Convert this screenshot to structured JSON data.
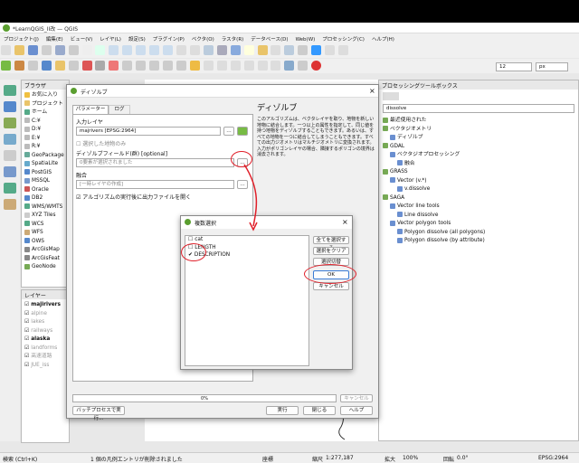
{
  "window_title": "*LearnQGIS_II改 — QGIS",
  "menu": [
    "プロジェクト(J)",
    "編集(E)",
    "ビュー(V)",
    "レイヤ(L)",
    "設定(S)",
    "プラグイン(P)",
    "ベクタ(O)",
    "ラスタ(R)",
    "データベース(D)",
    "Web(W)",
    "プロセッシング(C)",
    "ヘルプ(H)"
  ],
  "toolbar": {
    "zoom_value": "12",
    "zoom_unit": "px"
  },
  "browser": {
    "title": "ブラウザ",
    "items": [
      "お気に入り",
      "プロジェクト",
      "ホーム",
      "C:¥",
      "D:¥",
      "E:¥",
      "R:¥",
      "GeoPackage",
      "SpatiaLite",
      "PostGIS",
      "MSSQL",
      "Oracle",
      "DB2",
      "WMS/WMTS",
      "XYZ Tiles",
      "WCS",
      "WFS",
      "OWS",
      "ArcGisMap",
      "ArcGisFeat",
      "GeoNode"
    ]
  },
  "layers": {
    "title": "レイヤー",
    "items": [
      "majirivers",
      "alpine",
      "lakes",
      "railways",
      "alaska",
      "landforms",
      "高速道路",
      "JUE_iss"
    ]
  },
  "dissolve": {
    "title": "ディゾルブ",
    "tab_params": "パラメーター",
    "tab_log": "ログ",
    "input_label": "入力レイヤ",
    "input_value": "majrivers [EPSG:2964]",
    "selected_only": "選択した地物のみ",
    "field_label": "ディゾルブフィールド(群) [optional]",
    "field_value": "0要素が選択されました",
    "output_label": "融合",
    "output_value": "[一時レイヤの作成]",
    "open_output": "アルゴリズムの実行後に出力ファイルを開く",
    "help_title": "ディゾルブ",
    "help_text": "このアルゴリズムは、ベクタレイヤを取り、地物を新しい地物に結合します。一つ以上の属性を指定して、同じ値を持つ地物をディゾルブすることもできます。あるいは、すべての地物を一つに結合してしまうこともできます。すべての出力ジオメトリはマルチジオメトリに変換されます。入力がポリゴンレイヤの場合、隣接するポリゴンの境界は消去されます。",
    "progress": "0%",
    "cancel": "キャンセル",
    "batch": "バッチプロセスで実行...",
    "run": "実行",
    "close": "閉じる",
    "help": "ヘルプ"
  },
  "multi": {
    "title": "複数選択",
    "items": [
      "cat",
      "LENGTH",
      "DESCRIPTION"
    ],
    "checked": [
      false,
      false,
      true
    ],
    "select_all": "全てを選択する",
    "clear": "選択をクリア",
    "toggle": "選択切替",
    "ok": "OK",
    "cancel": "キャンセル"
  },
  "processing": {
    "title": "プロセッシングツールボックス",
    "search": "dissolve",
    "items": [
      "最近使用された",
      "ベクタジオメトリ",
      "ディゾルブ",
      "GDAL",
      "ベクタジオプロセッシング",
      "融合",
      "GRASS",
      "Vector (v.*)",
      "v.dissolve",
      "SAGA",
      "Vector line tools",
      "Line dissolve",
      "Vector polygon tools",
      "Polygon dissolve (all polygons)",
      "Polygon dissolve (by attribute)"
    ]
  },
  "status": {
    "search": "検索 (Ctrl+K)",
    "msg": "1 個の凡例エントリが削除されました",
    "coord": "座標",
    "scale": "縮尺",
    "scale_val": "1:277,187",
    "mag": "拡大",
    "mag_val": "100%",
    "rot": "回転",
    "rot_val": "0.0°",
    "crs": "EPSG:2964"
  }
}
